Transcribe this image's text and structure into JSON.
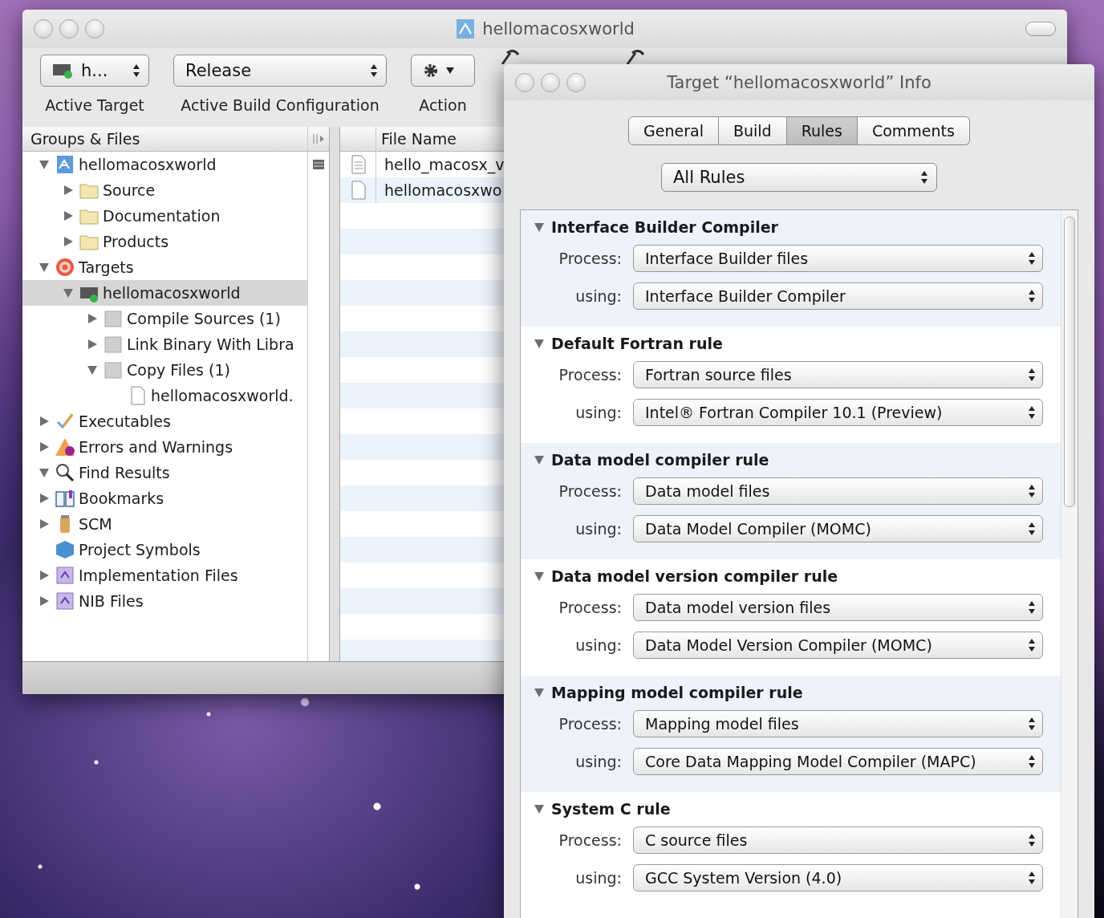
{
  "main_window": {
    "title": "hellomacosxworld",
    "toolbar": [
      {
        "kind": "popup",
        "value": "h...",
        "label": "Active Target"
      },
      {
        "kind": "popup",
        "value": "Release",
        "label": "Active Build Configuration"
      },
      {
        "kind": "action",
        "label": "Action"
      }
    ],
    "groups_header": "Groups & Files",
    "tree": [
      {
        "label": "hellomacosxworld",
        "kind": "project",
        "expanded": true,
        "selected": false,
        "children": [
          {
            "label": "Source",
            "kind": "folder",
            "expanded": false,
            "selected": false
          },
          {
            "label": "Documentation",
            "kind": "folder",
            "expanded": false,
            "selected": false
          },
          {
            "label": "Products",
            "kind": "folder",
            "expanded": false,
            "selected": false
          }
        ]
      },
      {
        "label": "Targets",
        "kind": "target",
        "expanded": true,
        "selected": false,
        "children": [
          {
            "label": "hellomacosxworld",
            "kind": "app",
            "expanded": true,
            "selected": true,
            "children": [
              {
                "label": "Compile Sources (1)",
                "kind": "phase",
                "expanded": false,
                "selected": false
              },
              {
                "label": "Link Binary With Libra",
                "kind": "phase",
                "expanded": false,
                "selected": false
              },
              {
                "label": "Copy Files (1)",
                "kind": "phase",
                "expanded": true,
                "selected": false,
                "children": [
                  {
                    "label": "hellomacosxworld.",
                    "kind": "file",
                    "selected": false
                  }
                ]
              }
            ]
          }
        ]
      },
      {
        "label": "Executables",
        "kind": "executables",
        "expanded": false,
        "selected": false
      },
      {
        "label": "Errors and Warnings",
        "kind": "errors",
        "expanded": false,
        "selected": false
      },
      {
        "label": "Find Results",
        "kind": "find",
        "expanded": true,
        "selected": false
      },
      {
        "label": "Bookmarks",
        "kind": "bookmarks",
        "expanded": false,
        "selected": false
      },
      {
        "label": "SCM",
        "kind": "scm",
        "expanded": false,
        "selected": false
      },
      {
        "label": "Project Symbols",
        "kind": "symbols",
        "selected": false
      },
      {
        "label": "Implementation Files",
        "kind": "smartgroup",
        "expanded": false,
        "selected": false
      },
      {
        "label": "NIB Files",
        "kind": "smartgroup",
        "expanded": false,
        "selected": false
      }
    ],
    "file_list": {
      "header": "File Name",
      "rows": [
        {
          "kind": "text",
          "name": "hello_macosx_v"
        },
        {
          "kind": "file",
          "name": "hellomacosxwo"
        }
      ]
    }
  },
  "info_window": {
    "title": "Target “hellomacosxworld” Info",
    "tabs": [
      {
        "label": "General",
        "selected": false
      },
      {
        "label": "Build",
        "selected": false
      },
      {
        "label": "Rules",
        "selected": true
      },
      {
        "label": "Comments",
        "selected": false
      }
    ],
    "filter": "All Rules",
    "rules": [
      {
        "name": "Interface Builder Compiler",
        "expanded": true,
        "process_label": "Process:",
        "process": "Interface Builder files",
        "using_label": "using:",
        "using": "Interface Builder Compiler"
      },
      {
        "name": "Default Fortran rule",
        "expanded": true,
        "process_label": "Process:",
        "process": "Fortran source files",
        "using_label": "using:",
        "using": "Intel® Fortran Compiler 10.1 (Preview)"
      },
      {
        "name": "Data model compiler rule",
        "expanded": true,
        "process_label": "Process:",
        "process": "Data model files",
        "using_label": "using:",
        "using": "Data Model Compiler (MOMC)"
      },
      {
        "name": "Data model version compiler rule",
        "expanded": true,
        "process_label": "Process:",
        "process": "Data model version files",
        "using_label": "using:",
        "using": "Data Model Version Compiler (MOMC)"
      },
      {
        "name": "Mapping model compiler rule",
        "expanded": true,
        "process_label": "Process:",
        "process": "Mapping model files",
        "using_label": "using:",
        "using": "Core Data Mapping Model Compiler (MAPC)"
      },
      {
        "name": "System C rule",
        "expanded": true,
        "process_label": "Process:",
        "process": "C source files",
        "using_label": "using:",
        "using": "GCC System Version (4.0)"
      }
    ]
  }
}
